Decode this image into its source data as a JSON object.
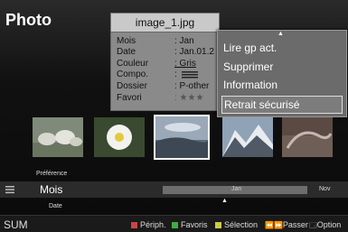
{
  "header": {
    "title": "Photo"
  },
  "info_panel": {
    "filename": "image_1.jpg",
    "rows": [
      {
        "key": "Mois",
        "value": ": Jan"
      },
      {
        "key": "Date",
        "value": ": Jan.01.2"
      },
      {
        "key": "Couleur",
        "value": ": Gris"
      },
      {
        "key": "Compo.",
        "value": ":"
      },
      {
        "key": "Dossier",
        "value": ": P-other"
      },
      {
        "key": "Favori",
        "value": ": ★★★"
      }
    ]
  },
  "menu": {
    "items": [
      {
        "label": "Lire gp act."
      },
      {
        "label": "Supprimer"
      },
      {
        "label": "Information"
      },
      {
        "label": "Retrait sécurisé"
      }
    ]
  },
  "thumbnails": [
    {
      "name": "rabbits"
    },
    {
      "name": "flower"
    },
    {
      "name": "sky",
      "selected": true
    },
    {
      "name": "mountains"
    },
    {
      "name": "sea"
    }
  ],
  "sort": {
    "preference_label": "Préférence",
    "current": "Mois",
    "date_label": "Date",
    "timeline_label": "Jan",
    "timeline_end": "Nov"
  },
  "bottom": {
    "left": "SUM",
    "legend": [
      {
        "color": "#c44",
        "label": "Périph."
      },
      {
        "color": "#4a4",
        "label": "Favoris"
      },
      {
        "color": "#cc4",
        "label": "Sélection"
      },
      {
        "icon": "⏪⏩",
        "label": "Passer"
      },
      {
        "icon": "🗔",
        "label": "Option"
      }
    ]
  },
  "colors": {
    "panel_bg": "#8a8a8a",
    "menu_bg": "#6b6b6b",
    "selected_border": "#ffffff"
  }
}
